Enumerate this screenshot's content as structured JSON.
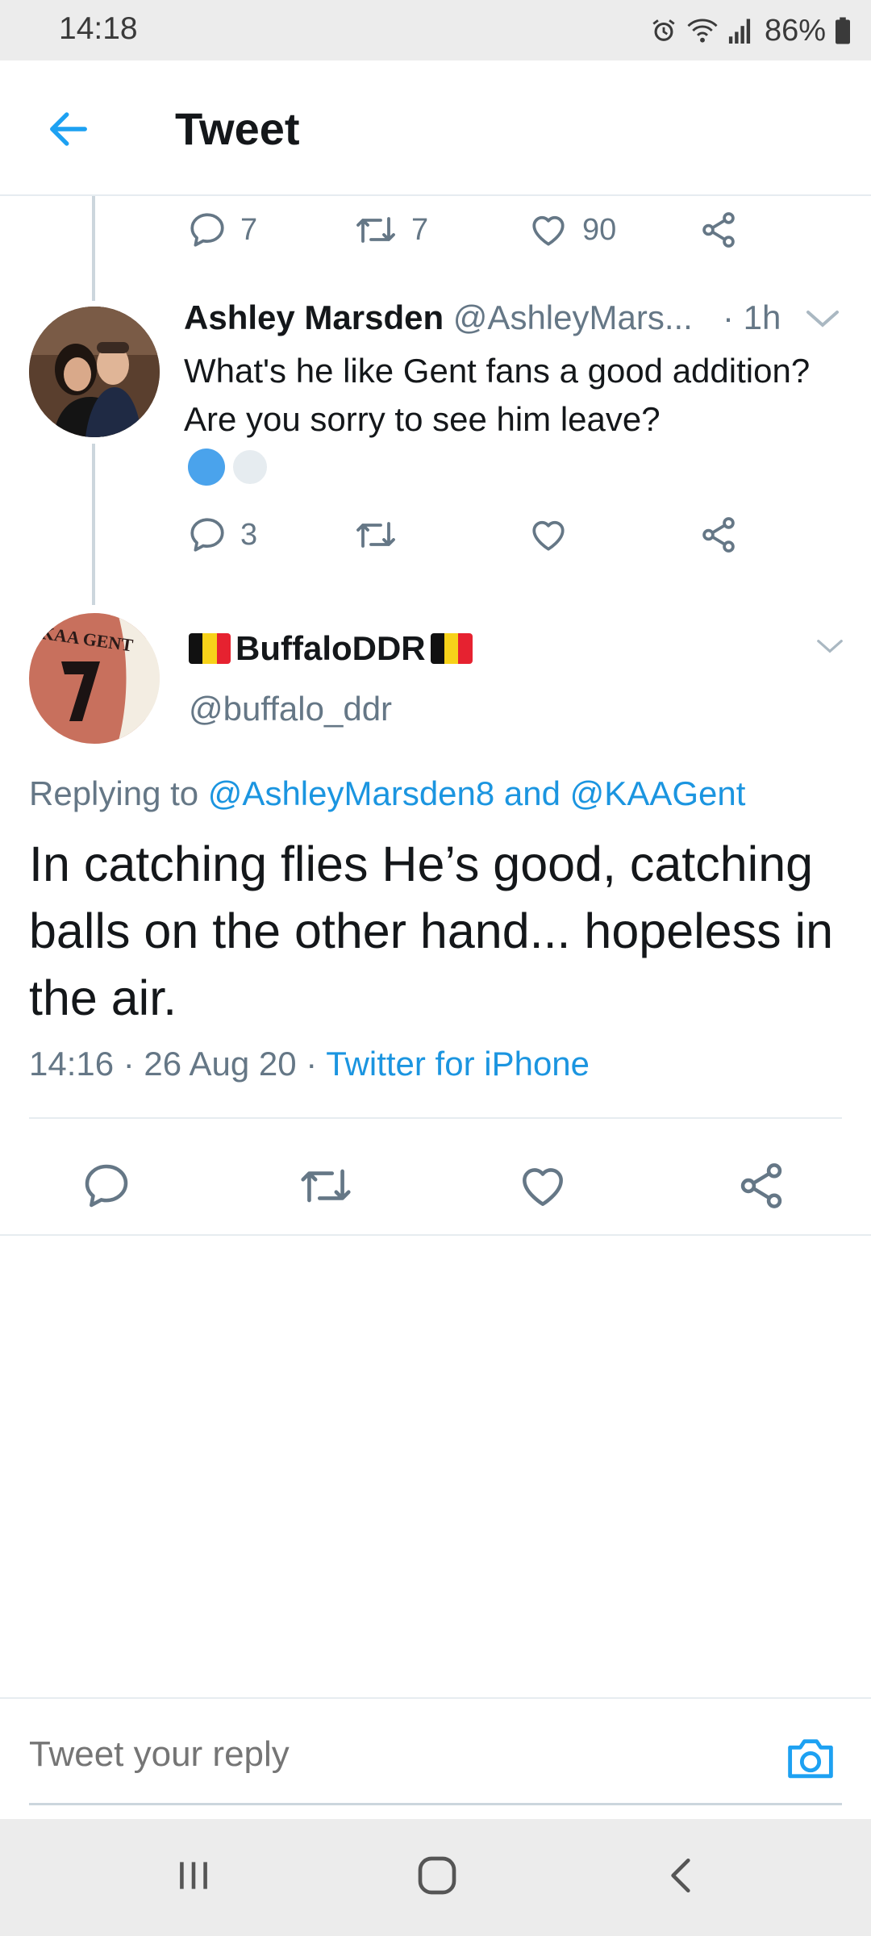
{
  "status_bar": {
    "time": "14:18",
    "battery": "86%",
    "icons": [
      "alarm-icon",
      "wifi-icon",
      "signal-icon",
      "battery-icon"
    ]
  },
  "app_bar": {
    "title": "Tweet",
    "back_icon": "arrow-left-icon"
  },
  "prev_tweet_actions": {
    "replies": "7",
    "retweets": "7",
    "likes": "90"
  },
  "reply_tweet": {
    "name": "Ashley Marsden",
    "handle": "@AshleyMars...",
    "time": "· 1h",
    "text": "What's he like Gent fans a good addition? Are you sorry to see him leave?",
    "actions": {
      "replies": "3",
      "retweets": "",
      "likes": ""
    }
  },
  "main_tweet": {
    "name": "BuffaloDDR",
    "handle": "@buffalo_ddr",
    "replying_prefix": "Replying to",
    "replying_to": "@AshleyMarsden8 and @KAAGent",
    "text": "In catching flies He’s good, catching balls on the other hand... hopeless in the air.",
    "meta_time": "14:16 · 26 Aug 20 ·",
    "source": "Twitter for iPhone",
    "avatar_text": "KAA GENT"
  },
  "composer": {
    "placeholder": "Tweet your reply"
  },
  "colors": {
    "accent": "#1da1f2",
    "link": "#1b95e0",
    "secondary_text": "#657786",
    "divider": "#e6ecf0"
  }
}
